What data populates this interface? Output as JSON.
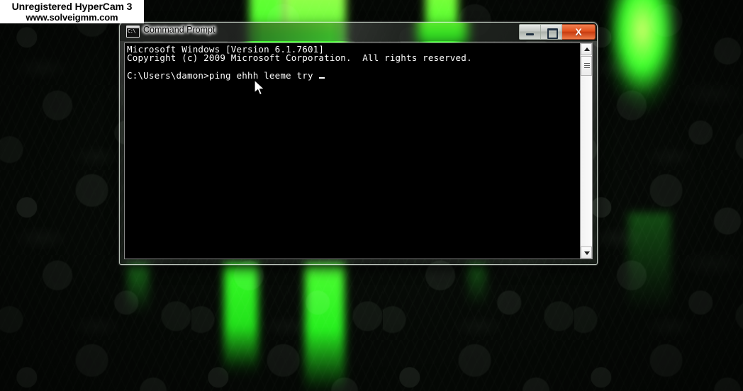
{
  "watermark": {
    "line1": "Unregistered HyperCam 3",
    "line2": "www.solveigmm.com"
  },
  "desktop": {
    "wallpaper_name": "green-damask-wallpaper",
    "base_color": "#060a06",
    "accent_color": "#2dff22"
  },
  "window": {
    "title": "Command Prompt",
    "icon": "command-prompt-icon",
    "icon_text": "C:\\",
    "controls": {
      "minimize": "–",
      "maximize": "□",
      "close": "X"
    }
  },
  "console": {
    "lines": [
      "Microsoft Windows [Version 6.1.7601]",
      "Copyright (c) 2009 Microsoft Corporation.  All rights reserved.",
      "",
      "C:\\Users\\damon>ping ehhh leeme try "
    ],
    "text": "Microsoft Windows [Version 6.1.7601]\nCopyright (c) 2009 Microsoft Corporation.  All rights reserved.\n\nC:\\Users\\damon>ping ehhh leeme try ",
    "prompt": "C:\\Users\\damon>",
    "command": "ping ehhh leeme try",
    "foreground_color": "#ffffff",
    "background_color": "#000000"
  },
  "scrollbar": {
    "up_arrow": "scroll-up",
    "down_arrow": "scroll-down",
    "thumb": "scroll-thumb"
  }
}
